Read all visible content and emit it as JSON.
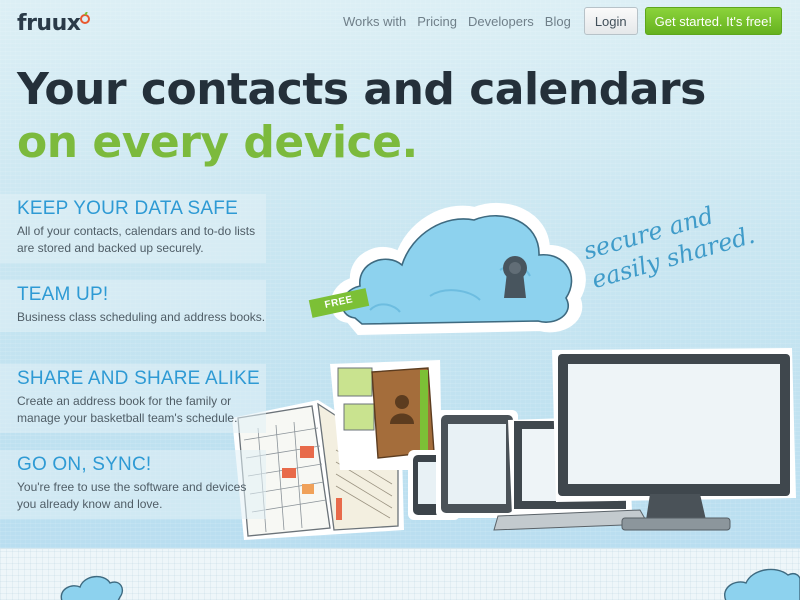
{
  "nav": {
    "logo_text": "fruux",
    "links": [
      "Works with",
      "Pricing",
      "Developers",
      "Blog"
    ],
    "login_label": "Login",
    "cta_label": "Get started. It's free!"
  },
  "hero": {
    "headline": "Your contacts and calendars",
    "subheadline": "on every device.",
    "script_text_1": "secure and",
    "script_text_2": "easily shared.",
    "free_tag": "FREE"
  },
  "features": [
    {
      "title": "KEEP YOUR DATA SAFE",
      "text": "All of your contacts, calendars and to-do lists are stored and backed up securely."
    },
    {
      "title": "TEAM UP!",
      "text": "Business class scheduling and address books."
    },
    {
      "title": "SHARE AND SHARE ALIKE",
      "text": "Create an address book for the family or manage your basketball team's schedule."
    },
    {
      "title": "GO ON, SYNC!",
      "text": "You're free to use the software and devices you already know and love."
    }
  ],
  "colors": {
    "accent_blue": "#2e9ad4",
    "accent_green": "#7cba3d",
    "cta_green": "#66b21f"
  },
  "icons": [
    "logo-mark-icon",
    "cloud-lock-icon",
    "calendar-book-icon",
    "address-book-icon",
    "phone-icon",
    "tablet-icon",
    "laptop-icon",
    "monitor-icon"
  ]
}
